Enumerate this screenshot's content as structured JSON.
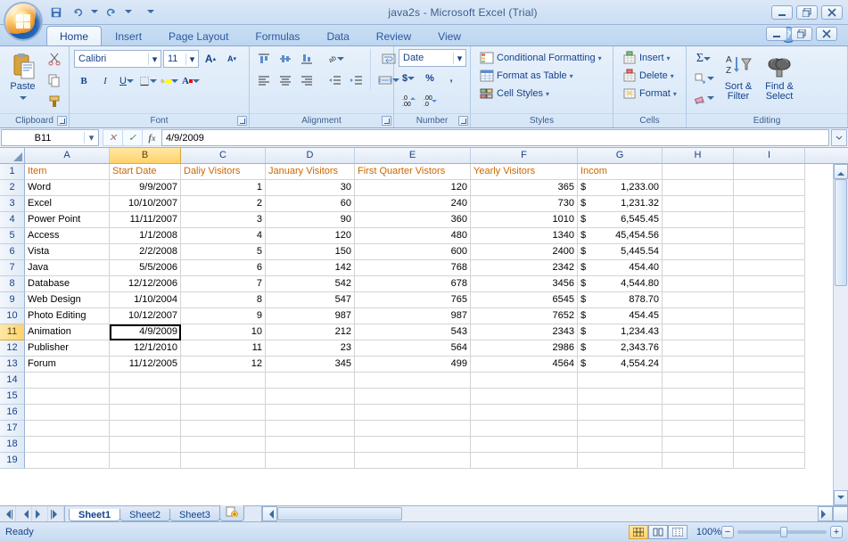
{
  "title": "java2s - Microsoft Excel (Trial)",
  "tabs": [
    "Home",
    "Insert",
    "Page Layout",
    "Formulas",
    "Data",
    "Review",
    "View"
  ],
  "activeTab": 0,
  "ribbon": {
    "clipboard": {
      "label": "Clipboard",
      "paste": "Paste"
    },
    "font": {
      "label": "Font",
      "name": "Calibri",
      "size": "11"
    },
    "alignment": {
      "label": "Alignment"
    },
    "number": {
      "label": "Number",
      "format": "Date"
    },
    "styles": {
      "label": "Styles",
      "cond": "Conditional Formatting",
      "tbl": "Format as Table",
      "cell": "Cell Styles"
    },
    "cells": {
      "label": "Cells",
      "ins": "Insert",
      "del": "Delete",
      "fmt": "Format"
    },
    "editing": {
      "label": "Editing",
      "sort": "Sort &\nFilter",
      "find": "Find &\nSelect"
    }
  },
  "namebox": "B11",
  "formula": "4/9/2009",
  "cols": [
    "A",
    "B",
    "C",
    "D",
    "E",
    "F",
    "G",
    "H",
    "I"
  ],
  "activeCell": {
    "r": 11,
    "c": "B"
  },
  "headers": {
    "A": "Item",
    "B": "Start Date",
    "C": "Daliy Visitors",
    "D": "January Visitors",
    "E": "First Quarter Vistors",
    "F": "Yearly Visitors",
    "G": "Incom"
  },
  "rows": [
    {
      "A": "Word",
      "B": "9/9/2007",
      "C": "1",
      "D": "30",
      "E": "120",
      "F": "365",
      "G": "1,233.00"
    },
    {
      "A": "Excel",
      "B": "10/10/2007",
      "C": "2",
      "D": "60",
      "E": "240",
      "F": "730",
      "G": "1,231.32"
    },
    {
      "A": "Power Point",
      "B": "11/11/2007",
      "C": "3",
      "D": "90",
      "E": "360",
      "F": "1010",
      "G": "6,545.45"
    },
    {
      "A": "Access",
      "B": "1/1/2008",
      "C": "4",
      "D": "120",
      "E": "480",
      "F": "1340",
      "G": "45,454.56"
    },
    {
      "A": "Vista",
      "B": "2/2/2008",
      "C": "5",
      "D": "150",
      "E": "600",
      "F": "2400",
      "G": "5,445.54"
    },
    {
      "A": "Java",
      "B": "5/5/2006",
      "C": "6",
      "D": "142",
      "E": "768",
      "F": "2342",
      "G": "454.40"
    },
    {
      "A": "Database",
      "B": "12/12/2006",
      "C": "7",
      "D": "542",
      "E": "678",
      "F": "3456",
      "G": "4,544.80"
    },
    {
      "A": "Web Design",
      "B": "1/10/2004",
      "C": "8",
      "D": "547",
      "E": "765",
      "F": "6545",
      "G": "878.70"
    },
    {
      "A": "Photo Editing",
      "B": "10/12/2007",
      "C": "9",
      "D": "987",
      "E": "987",
      "F": "7652",
      "G": "454.45"
    },
    {
      "A": "Animation",
      "B": "4/9/2009",
      "C": "10",
      "D": "212",
      "E": "543",
      "F": "2343",
      "G": "1,234.43"
    },
    {
      "A": "Publisher",
      "B": "12/1/2010",
      "C": "11",
      "D": "23",
      "E": "564",
      "F": "2986",
      "G": "2,343.76"
    },
    {
      "A": "Forum",
      "B": "11/12/2005",
      "C": "12",
      "D": "345",
      "E": "499",
      "F": "4564",
      "G": "4,554.24"
    }
  ],
  "currency": "$",
  "sheets": [
    "Sheet1",
    "Sheet2",
    "Sheet3"
  ],
  "activeSheet": 0,
  "status": "Ready",
  "zoom": "100%"
}
